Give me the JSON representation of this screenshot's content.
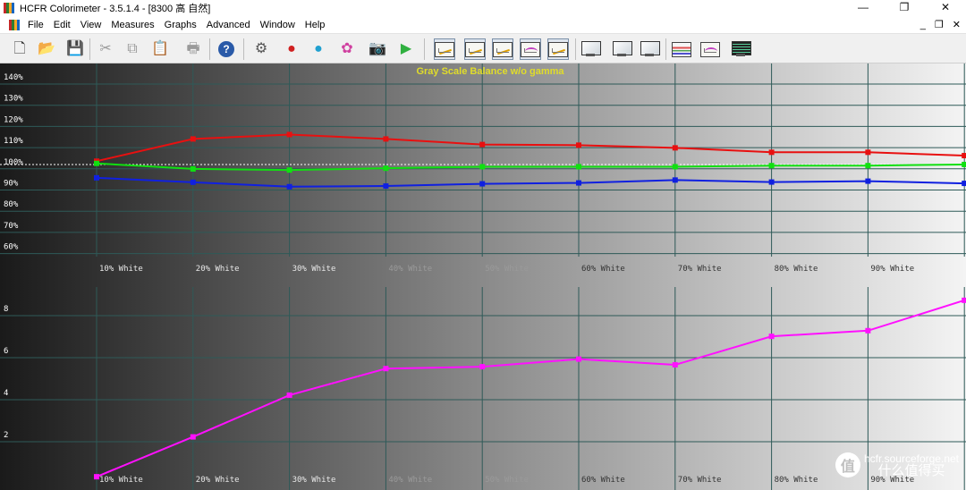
{
  "window": {
    "title": "HCFR Colorimeter - 3.5.1.4 - [8300 高 自然]",
    "minimize_glyph": "—",
    "restore_glyph": "❐",
    "close_glyph": "✕"
  },
  "menu": {
    "items": [
      "File",
      "Edit",
      "View",
      "Measures",
      "Graphs",
      "Advanced",
      "Window",
      "Help"
    ],
    "mdi_minimize": "_",
    "mdi_restore": "❐",
    "mdi_close": "✕"
  },
  "toolbar": {
    "buttons": [
      {
        "name": "new-document-icon",
        "glyph": "🗋",
        "color": "#333333"
      },
      {
        "name": "open-folder-icon",
        "glyph": "📂",
        "color": "#d8a020"
      },
      {
        "name": "save-disk-icon",
        "glyph": "💾",
        "color": "#3050a0"
      },
      {
        "name": "cut-icon",
        "glyph": "✂",
        "color": "#9a9a9a"
      },
      {
        "name": "copy-icon",
        "glyph": "⧉",
        "color": "#9a9a9a"
      },
      {
        "name": "paste-icon",
        "glyph": "📋",
        "color": "#9a9a9a"
      },
      {
        "name": "print-icon",
        "glyph": "🖶",
        "color": "#9a9a9a"
      },
      {
        "name": "help-icon",
        "glyph": "?",
        "color": "#ffffff"
      },
      {
        "name": "measure-gray-icon",
        "glyph": "⚙",
        "color": "#555555"
      },
      {
        "name": "measure-primaries-icon",
        "glyph": "●",
        "color": "#d02020"
      },
      {
        "name": "measure-secondaries-icon",
        "glyph": "●",
        "color": "#20a0d0"
      },
      {
        "name": "measure-saturation-icon",
        "glyph": "✿",
        "color": "#d040a0"
      },
      {
        "name": "camera-icon",
        "glyph": "📷",
        "color": "#555555"
      },
      {
        "name": "play-icon",
        "glyph": "▶",
        "color": "#30b040"
      }
    ],
    "graph_buttons": [
      "luminance-graph-icon",
      "gamma-graph-icon",
      "rgb-levels-graph-icon",
      "colortemp-graph-icon",
      "deltae-graph-icon"
    ],
    "view_buttons": [
      "cie-diagram-icon",
      "measures-monitor-icon",
      "saturation-monitor-icon",
      "contrast-monitor-icon",
      "colors-list-icon",
      "near-black-icon",
      "dark-monitor-icon"
    ]
  },
  "chart_data": [
    {
      "type": "line",
      "title": "Gray Scale Balance w/o gamma",
      "categories": [
        "10% White",
        "20% White",
        "30% White",
        "40% White",
        "50% White",
        "60% White",
        "70% White",
        "80% White",
        "90% White"
      ],
      "x": [
        10,
        20,
        30,
        40,
        50,
        60,
        70,
        80,
        90,
        100
      ],
      "yticks": [
        "140%",
        "130%",
        "120%",
        "110%",
        "100%",
        "90%",
        "80%",
        "70%",
        "60%"
      ],
      "ylim": [
        57,
        144
      ],
      "reference": 98.5,
      "grid": true,
      "series": [
        {
          "color": "#e81010",
          "values": [
            100,
            110,
            112,
            110,
            107.5,
            107.2,
            106,
            104,
            104,
            102.5
          ]
        },
        {
          "color": "#10e010",
          "values": [
            99,
            96.5,
            96,
            96.8,
            97.5,
            97.5,
            97.5,
            98,
            98,
            98.5
          ]
        },
        {
          "color": "#1020e0",
          "values": [
            92.5,
            90.5,
            88.5,
            88.8,
            89.8,
            90.2,
            91.5,
            90.6,
            91,
            90
          ]
        }
      ]
    },
    {
      "type": "line",
      "categories": [
        "10% White",
        "20% White",
        "30% White",
        "40% White",
        "50% White",
        "60% White",
        "70% White",
        "80% White",
        "90% White"
      ],
      "x": [
        10,
        20,
        30,
        40,
        50,
        60,
        70,
        80,
        90,
        100
      ],
      "yticks": [
        "8",
        "6",
        "4",
        "2"
      ],
      "ylim": [
        -0.5,
        10.2
      ],
      "grid": true,
      "series": [
        {
          "color": "#ff10ff",
          "values": [
            0.2,
            2.3,
            4.5,
            5.9,
            6.0,
            6.4,
            6.1,
            7.6,
            7.9,
            9.5
          ]
        }
      ]
    }
  ],
  "watermark": {
    "logo_glyph": "值",
    "line1": "hcfr.sourceforge.net",
    "line2": "什么值得买"
  }
}
